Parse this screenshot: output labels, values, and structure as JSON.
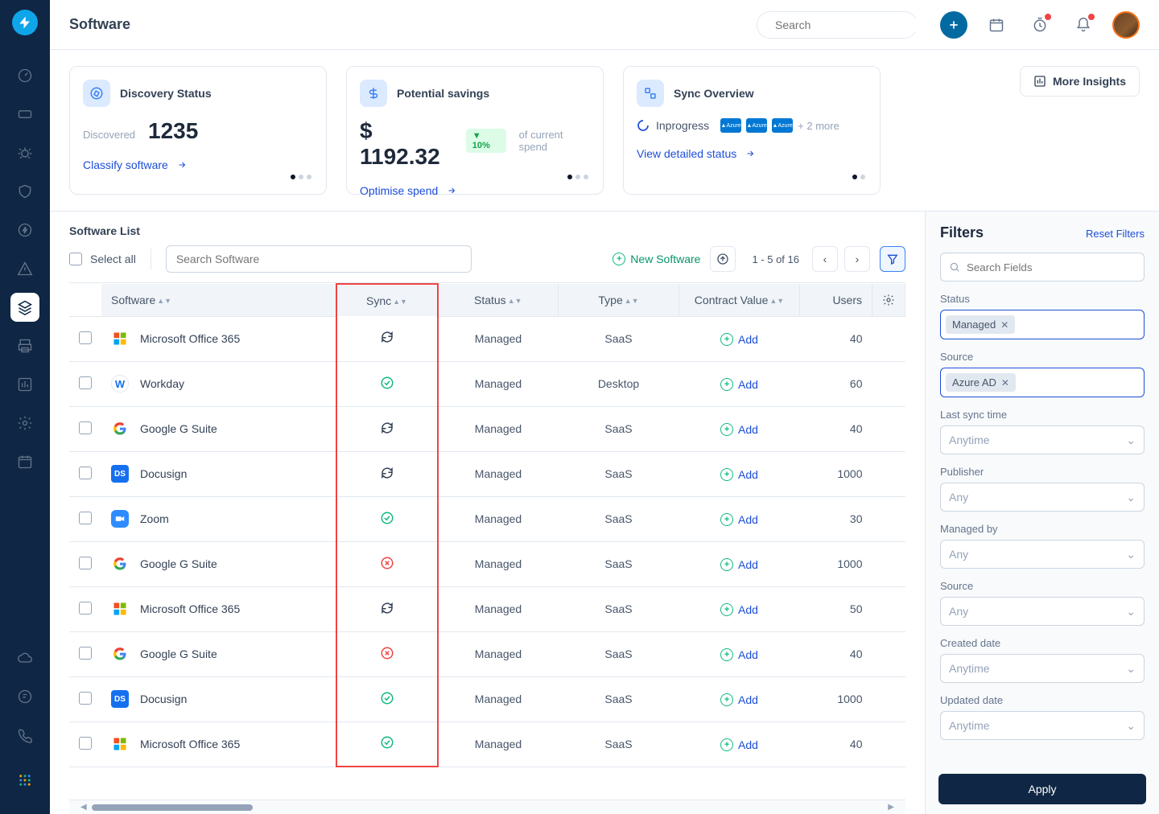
{
  "header": {
    "title": "Software",
    "search_placeholder": "Search"
  },
  "sidebar": {
    "items": [
      {
        "name": "gauge-icon"
      },
      {
        "name": "ticket-icon"
      },
      {
        "name": "bug-icon"
      },
      {
        "name": "shield-icon"
      },
      {
        "name": "bolt-icon"
      },
      {
        "name": "warning-icon"
      },
      {
        "name": "layers-icon",
        "active": true
      },
      {
        "name": "printer-icon"
      },
      {
        "name": "chart-icon"
      },
      {
        "name": "gear-icon"
      },
      {
        "name": "calendar-day-icon"
      }
    ],
    "bottom": [
      {
        "name": "cloud-icon"
      },
      {
        "name": "note-icon"
      },
      {
        "name": "phone-icon"
      }
    ]
  },
  "cards": {
    "discovery": {
      "title": "Discovery Status",
      "label": "Discovered",
      "value": "1235",
      "link": "Classify software"
    },
    "savings": {
      "title": "Potential savings",
      "value": "$ 1192.32",
      "pct": "▼ 10%",
      "pct_note": "of current spend",
      "link": "Optimise spend"
    },
    "sync": {
      "title": "Sync Overview",
      "status": "Inprogress",
      "more": "+ 2 more",
      "link": "View detailed status"
    },
    "more_insights": "More Insights"
  },
  "list": {
    "title": "Software List",
    "select_all": "Select all",
    "search_placeholder": "Search Software",
    "new_software": "New Software",
    "pager": "1 - 5 of 16",
    "columns": {
      "software": "Software",
      "sync": "Sync",
      "status": "Status",
      "type": "Type",
      "contract": "Contract Value",
      "users": "Users"
    },
    "add_label": "Add",
    "rows": [
      {
        "app": "Microsoft Office 365",
        "icon": "ms",
        "sync": "syncing",
        "status": "Managed",
        "type": "SaaS",
        "users": "40"
      },
      {
        "app": "Workday",
        "icon": "wd",
        "sync": "ok",
        "status": "Managed",
        "type": "Desktop",
        "users": "60"
      },
      {
        "app": "Google G Suite",
        "icon": "gg",
        "sync": "syncing",
        "status": "Managed",
        "type": "SaaS",
        "users": "40"
      },
      {
        "app": "Docusign",
        "icon": "ds",
        "sync": "syncing",
        "status": "Managed",
        "type": "SaaS",
        "users": "1000"
      },
      {
        "app": "Zoom",
        "icon": "zm",
        "sync": "ok",
        "status": "Managed",
        "type": "SaaS",
        "users": "30"
      },
      {
        "app": "Google G Suite",
        "icon": "gg",
        "sync": "fail",
        "status": "Managed",
        "type": "SaaS",
        "users": "1000"
      },
      {
        "app": "Microsoft Office 365",
        "icon": "ms",
        "sync": "syncing",
        "status": "Managed",
        "type": "SaaS",
        "users": "50"
      },
      {
        "app": "Google G Suite",
        "icon": "gg",
        "sync": "fail",
        "status": "Managed",
        "type": "SaaS",
        "users": "40"
      },
      {
        "app": "Docusign",
        "icon": "ds",
        "sync": "ok",
        "status": "Managed",
        "type": "SaaS",
        "users": "1000"
      },
      {
        "app": "Microsoft Office 365",
        "icon": "ms",
        "sync": "ok",
        "status": "Managed",
        "type": "SaaS",
        "users": "40"
      }
    ]
  },
  "filters": {
    "title": "Filters",
    "reset": "Reset Filters",
    "search_placeholder": "Search Fields",
    "status_label": "Status",
    "status_tag": "Managed",
    "source_label": "Source",
    "source_tag": "Azure AD",
    "last_sync_label": "Last sync time",
    "anytime": "Anytime",
    "publisher_label": "Publisher",
    "any": "Any",
    "managed_by_label": "Managed by",
    "source2_label": "Source",
    "created_label": "Created date",
    "updated_label": "Updated date",
    "apply": "Apply"
  }
}
